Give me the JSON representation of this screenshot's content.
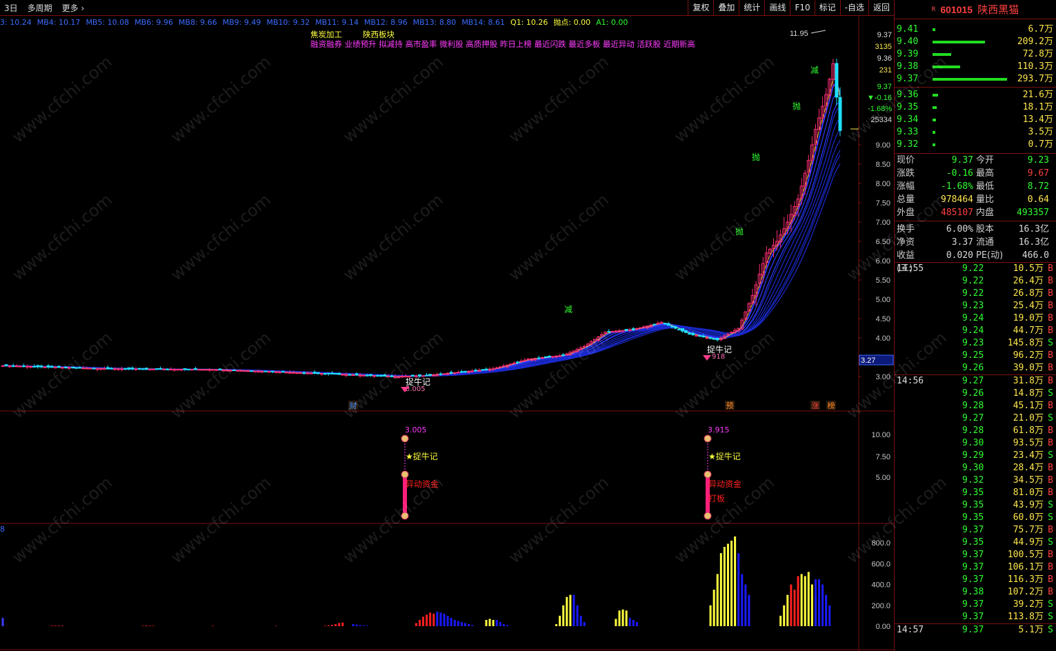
{
  "toolbar": {
    "period": "3日",
    "multi_period": "多周期",
    "more": "更多",
    "buttons": [
      "复权",
      "叠加",
      "统计",
      "画线",
      "F10",
      "标记",
      "-自选",
      "返回"
    ]
  },
  "ma_legend": [
    {
      "text": "3: 10.24",
      "color": "#3a6bff"
    },
    {
      "text": "MB4: 10.17",
      "color": "#3a6bff"
    },
    {
      "text": "MB5: 10.08",
      "color": "#3a6bff"
    },
    {
      "text": "MB6: 9.96",
      "color": "#3a6bff"
    },
    {
      "text": "MB8: 9.66",
      "color": "#3a6bff"
    },
    {
      "text": "MB9: 9.49",
      "color": "#3a6bff"
    },
    {
      "text": "MB10: 9.32",
      "color": "#3a6bff"
    },
    {
      "text": "MB11: 9.14",
      "color": "#3a6bff"
    },
    {
      "text": "MB12: 8.96",
      "color": "#3a6bff"
    },
    {
      "text": "MB13: 8.80",
      "color": "#3a6bff"
    },
    {
      "text": "MB14: 8.61",
      "color": "#3a6bff"
    },
    {
      "text": "Q1: 10.26",
      "color": "#ffff40"
    },
    {
      "text": "抛点: 0.00",
      "color": "#ffff40"
    },
    {
      "text": "A1: 0.00",
      "color": "#30ff30"
    }
  ],
  "concepts": {
    "line1": [
      "焦炭加工",
      "陕西板块"
    ],
    "line2": "融资融券 业绩预升 拟减持 高市盈率 微利股 高质押股 昨日上榜 最近闪跌 最近多板 最近异动 活跃股 近期新高"
  },
  "price_axis": [
    "9.37",
    "3135",
    "9.36",
    "231",
    "9.37",
    "▼-0.16",
    "-1.68%",
    "25334",
    "9.00",
    "8.50",
    "8.00",
    "7.50",
    "7.00",
    "6.50",
    "6.00",
    "5.50",
    "5.00",
    "4.50",
    "4.00",
    "3.00"
  ],
  "price_ticks": [
    "9.00",
    "8.50",
    "8.00",
    "7.50",
    "7.00",
    "6.50",
    "6.00",
    "5.50",
    "5.00",
    "4.50",
    "4.00",
    "3.00"
  ],
  "cross_price": "3.27",
  "high_label": "11.95",
  "event_markers": [
    "财",
    "预",
    "涨",
    "榜"
  ],
  "signals": {
    "buy_label": "捉牛记",
    "sell_1": "抛",
    "sell_2": "减",
    "low1": "3.005",
    "low2": "3.915",
    "low2_short": "918"
  },
  "indicator_axis": [
    "10.00",
    "7.50",
    "5.00"
  ],
  "indicator_labels": {
    "p1": "3.005",
    "p2": "3.915",
    "star": "★捉牛记",
    "fund": "异动资金",
    "board": "打板"
  },
  "vol_axis": [
    "800.0",
    "600.0",
    "400.0",
    "200.0",
    "0.00"
  ],
  "vol_corner": "8",
  "stock": {
    "code": "601015",
    "name": "陕西黑猫",
    "flag": "R"
  },
  "orderbook_sell": [
    {
      "price": "9.41",
      "vol": "6.7万",
      "bar": 0.02
    },
    {
      "price": "9.40",
      "vol": "209.2万",
      "bar": 0.7
    },
    {
      "price": "9.39",
      "vol": "72.8万",
      "bar": 0.25
    },
    {
      "price": "9.38",
      "vol": "110.3万",
      "bar": 0.37
    },
    {
      "price": "9.37",
      "vol": "293.7万",
      "bar": 1.0
    }
  ],
  "orderbook_buy": [
    {
      "price": "9.36",
      "vol": "21.6万",
      "bar": 0.07
    },
    {
      "price": "9.35",
      "vol": "18.1万",
      "bar": 0.06
    },
    {
      "price": "9.34",
      "vol": "13.4万",
      "bar": 0.05
    },
    {
      "price": "9.33",
      "vol": "3.5万",
      "bar": 0.02
    },
    {
      "price": "9.32",
      "vol": "0.7万",
      "bar": 0.01
    }
  ],
  "stats": [
    {
      "l1": "现价",
      "v1": "9.37",
      "c1": "#30ff30",
      "l2": "今开",
      "v2": "9.23",
      "c2": "#30ff30"
    },
    {
      "l1": "涨跌",
      "v1": "-0.16",
      "c1": "#30ff30",
      "l2": "最高",
      "v2": "9.67",
      "c2": "#ff4040"
    },
    {
      "l1": "涨幅",
      "v1": "-1.68%",
      "c1": "#30ff30",
      "l2": "最低",
      "v2": "8.72",
      "c2": "#30ff30"
    },
    {
      "l1": "总量",
      "v1": "978464",
      "c1": "#ffe84d",
      "l2": "量比",
      "v2": "0.64",
      "c2": "#ffe84d"
    },
    {
      "l1": "外盘",
      "v1": "485107",
      "c1": "#ff4040",
      "l2": "内盘",
      "v2": "493357",
      "c2": "#30ff30"
    },
    {
      "l1": "换手",
      "v1": "6.00%",
      "c1": "#dcdcdc",
      "l2": "股本",
      "v2": "16.3亿",
      "c2": "#dcdcdc",
      "sep": true
    },
    {
      "l1": "净资",
      "v1": "3.37",
      "c1": "#dcdcdc",
      "l2": "流通",
      "v2": "16.3亿",
      "c2": "#dcdcdc"
    },
    {
      "l1": "收益(三)",
      "v1": "0.020",
      "c1": "#dcdcdc",
      "l2": "PE(动)",
      "v2": "466.0",
      "c2": "#dcdcdc"
    }
  ],
  "ticks": [
    {
      "t": "14:55",
      "p": "9.22",
      "v": "10.5万",
      "d": "B"
    },
    {
      "t": "",
      "p": "9.22",
      "v": "26.4万",
      "d": "B"
    },
    {
      "t": "",
      "p": "9.22",
      "v": "26.8万",
      "d": "B"
    },
    {
      "t": "",
      "p": "9.23",
      "v": "25.4万",
      "d": "B"
    },
    {
      "t": "",
      "p": "9.24",
      "v": "19.0万",
      "d": "B"
    },
    {
      "t": "",
      "p": "9.24",
      "v": "44.7万",
      "d": "B"
    },
    {
      "t": "",
      "p": "9.23",
      "v": "145.8万",
      "d": "S"
    },
    {
      "t": "",
      "p": "9.25",
      "v": "96.2万",
      "d": "B"
    },
    {
      "t": "",
      "p": "9.26",
      "v": "39.0万",
      "d": "B"
    },
    {
      "t": "14:56",
      "p": "9.27",
      "v": "31.8万",
      "d": "B",
      "sep": true
    },
    {
      "t": "",
      "p": "9.26",
      "v": "14.8万",
      "d": "S"
    },
    {
      "t": "",
      "p": "9.28",
      "v": "45.1万",
      "d": "B"
    },
    {
      "t": "",
      "p": "9.27",
      "v": "21.0万",
      "d": "S"
    },
    {
      "t": "",
      "p": "9.28",
      "v": "61.8万",
      "d": "B"
    },
    {
      "t": "",
      "p": "9.30",
      "v": "93.5万",
      "d": "B"
    },
    {
      "t": "",
      "p": "9.29",
      "v": "23.4万",
      "d": "S"
    },
    {
      "t": "",
      "p": "9.30",
      "v": "28.4万",
      "d": "B"
    },
    {
      "t": "",
      "p": "9.32",
      "v": "34.5万",
      "d": "B"
    },
    {
      "t": "",
      "p": "9.35",
      "v": "81.0万",
      "d": "B"
    },
    {
      "t": "",
      "p": "9.35",
      "v": "43.9万",
      "d": "S"
    },
    {
      "t": "",
      "p": "9.35",
      "v": "60.0万",
      "d": "S"
    },
    {
      "t": "",
      "p": "9.37",
      "v": "75.7万",
      "d": "B"
    },
    {
      "t": "",
      "p": "9.35",
      "v": "44.9万",
      "d": "S"
    },
    {
      "t": "",
      "p": "9.37",
      "v": "100.5万",
      "d": "B"
    },
    {
      "t": "",
      "p": "9.37",
      "v": "106.1万",
      "d": "B"
    },
    {
      "t": "",
      "p": "9.37",
      "v": "116.3万",
      "d": "B"
    },
    {
      "t": "",
      "p": "9.38",
      "v": "107.2万",
      "d": "B"
    },
    {
      "t": "",
      "p": "9.37",
      "v": "39.2万",
      "d": "S"
    },
    {
      "t": "",
      "p": "9.37",
      "v": "113.8万",
      "d": "S"
    },
    {
      "t": "14:57",
      "p": "9.37",
      "v": "5.1万",
      "d": "S",
      "sep": true
    }
  ],
  "watermark": "www.cfchi.com"
}
